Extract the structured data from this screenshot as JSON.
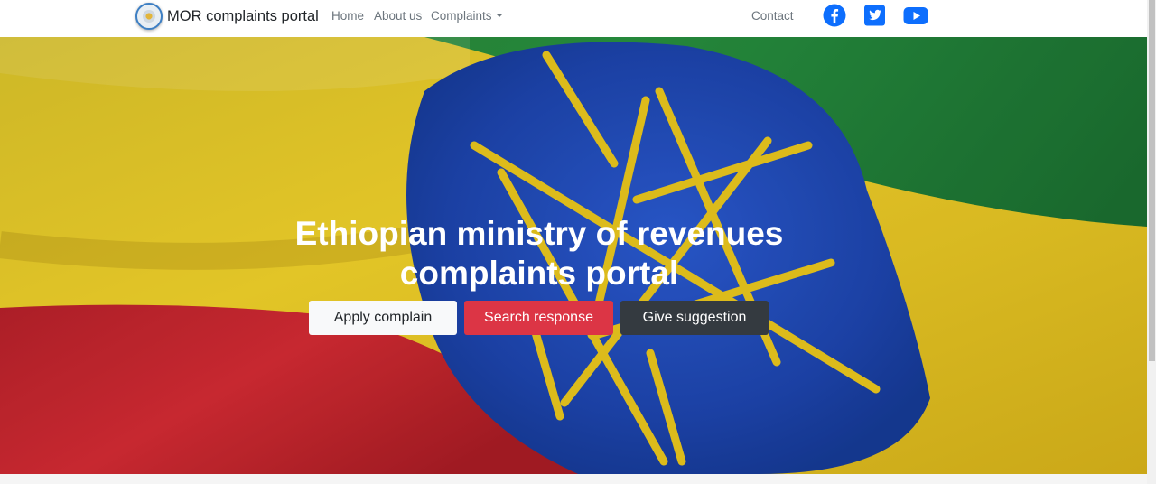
{
  "navbar": {
    "brand": "MOR complaints portal",
    "links": {
      "home": "Home",
      "about": "About us",
      "complaints": "Complaints",
      "contact": "Contact"
    },
    "social": [
      "facebook-icon",
      "twitter-icon",
      "youtube-icon"
    ],
    "social_color": "#0d6efd"
  },
  "hero": {
    "title_line1": "Ethiopian ministry of revenues",
    "title_line2": "complaints portal",
    "buttons": {
      "apply": "Apply complain",
      "search": "Search response",
      "suggest": "Give suggestion"
    },
    "colors": {
      "green": "#1f8a3b",
      "yellow": "#e8c61d",
      "red": "#c8232c",
      "blue": "#1f48b0",
      "star": "#e8c61d"
    }
  }
}
